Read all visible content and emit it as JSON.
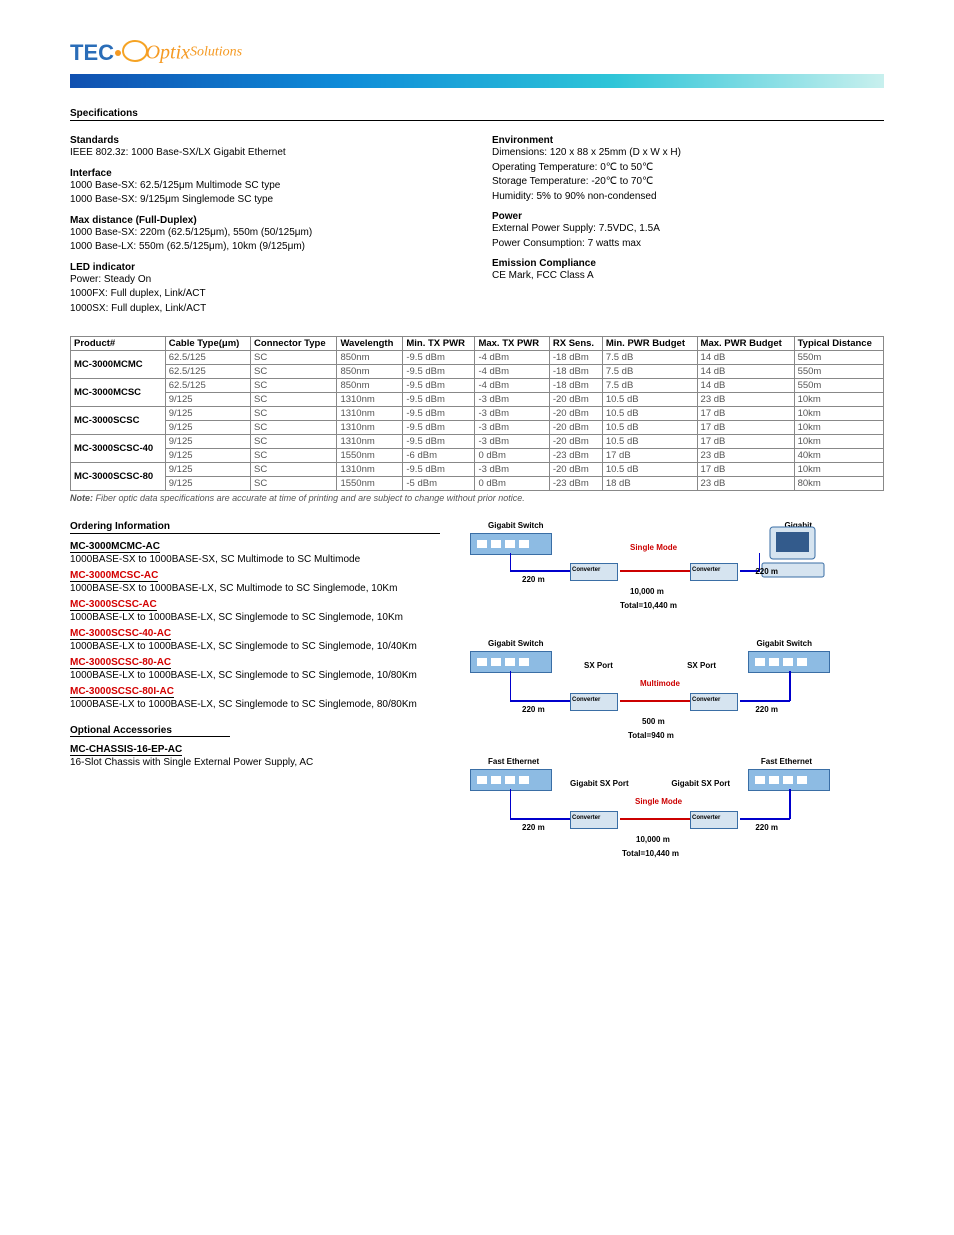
{
  "logo": {
    "part1": "TEC",
    "part2": "Optix",
    "part3": "Solutions"
  },
  "specs_title": "Specifications",
  "standards": {
    "heading": "Standards",
    "items": [
      {
        "k": "IEEE 802.3z:",
        "v": "1000 Base-SX/LX Gigabit Ethernet"
      }
    ],
    "interface_heading": "Interface",
    "interface": [
      {
        "k": "1000 Base-SX:",
        "v": "62.5/125μm Multimode SC type"
      },
      {
        "k": "1000 Base-SX:",
        "v": "9/125μm Singlemode SC type"
      }
    ],
    "distance_heading": "Max distance (Full-Duplex)",
    "distance": [
      {
        "k": "1000 Base-SX:",
        "v": "220m (62.5/125μm), 550m (50/125μm)"
      },
      {
        "k": "1000 Base-LX:",
        "v": "550m (62.5/125μm), 10km (9/125μm)"
      }
    ],
    "led_heading": "LED indicator",
    "led": [
      {
        "k": "Power:",
        "v": "Steady On"
      },
      {
        "k": "1000FX:",
        "v": "Full duplex, Link/ACT"
      },
      {
        "k": "1000SX:",
        "v": "Full duplex, Link/ACT"
      }
    ]
  },
  "env": {
    "heading": "Environment",
    "items": [
      {
        "k": "Dimensions:",
        "v": "120 x 88 x 25mm (D x W x H)"
      },
      {
        "k": "Operating Temperature:",
        "v": "0℃ to 50℃"
      },
      {
        "k": "Storage Temperature:",
        "v": "-20℃ to 70℃"
      },
      {
        "k": "Humidity:",
        "v": "5% to 90% non-condensed"
      }
    ],
    "power_heading": "Power",
    "power": [
      {
        "k": "External Power Supply:",
        "v": "7.5VDC, 1.5A"
      },
      {
        "k": "Power Consumption:",
        "v": "7 watts max"
      }
    ],
    "emission_heading": "Emission Compliance",
    "emission": [
      {
        "k": "",
        "v": "CE Mark, FCC Class A"
      }
    ]
  },
  "note_label": "Note:",
  "note_text": "Fiber optic data specifications are accurate at time of printing and are subject to change without prior notice.",
  "table": {
    "headers": [
      "Product#",
      "Cable Type(μm)",
      "Connector Type",
      "Wavelength",
      "Min. TX PWR",
      "Max. TX PWR",
      "RX Sens.",
      "Min. PWR Budget",
      "Max. PWR Budget",
      "Typical Distance"
    ],
    "rows": [
      {
        "product": "MC-3000MCMC",
        "sub": [
          {
            "c": [
              "62.5/125",
              "SC",
              "850nm",
              "-9.5 dBm",
              "-4 dBm",
              "-18 dBm",
              "7.5 dB",
              "14 dB",
              "550m"
            ]
          },
          {
            "c": [
              "62.5/125",
              "SC",
              "850nm",
              "-9.5 dBm",
              "-4 dBm",
              "-18 dBm",
              "7.5 dB",
              "14 dB",
              "550m"
            ]
          }
        ]
      },
      {
        "product": "MC-3000MCSC",
        "sub": [
          {
            "c": [
              "62.5/125",
              "SC",
              "850nm",
              "-9.5 dBm",
              "-4 dBm",
              "-18 dBm",
              "7.5 dB",
              "14 dB",
              "550m"
            ]
          },
          {
            "c": [
              "9/125",
              "SC",
              "1310nm",
              "-9.5 dBm",
              "-3 dBm",
              "-20 dBm",
              "10.5 dB",
              "23 dB",
              "10km"
            ]
          }
        ]
      },
      {
        "product": "MC-3000SCSC",
        "sub": [
          {
            "c": [
              "9/125",
              "SC",
              "1310nm",
              "-9.5 dBm",
              "-3 dBm",
              "-20 dBm",
              "10.5 dB",
              "17 dB",
              "10km"
            ]
          },
          {
            "c": [
              "9/125",
              "SC",
              "1310nm",
              "-9.5 dBm",
              "-3 dBm",
              "-20 dBm",
              "10.5 dB",
              "17 dB",
              "10km"
            ]
          }
        ]
      },
      {
        "product": "MC-3000SCSC-40",
        "sub": [
          {
            "c": [
              "9/125",
              "SC",
              "1310nm",
              "-9.5 dBm",
              "-3 dBm",
              "-20 dBm",
              "10.5 dB",
              "17 dB",
              "10km"
            ]
          },
          {
            "c": [
              "9/125",
              "SC",
              "1550nm",
              "-6 dBm",
              "0 dBm",
              "-23 dBm",
              "17 dB",
              "23 dB",
              "40km"
            ]
          }
        ]
      },
      {
        "product": "MC-3000SCSC-80",
        "sub": [
          {
            "c": [
              "9/125",
              "SC",
              "1310nm",
              "-9.5 dBm",
              "-3 dBm",
              "-20 dBm",
              "10.5 dB",
              "17 dB",
              "10km"
            ]
          },
          {
            "c": [
              "9/125",
              "SC",
              "1550nm",
              "-5 dBm",
              "0 dBm",
              "-23 dBm",
              "18 dB",
              "23 dB",
              "80km"
            ]
          }
        ]
      }
    ]
  },
  "ordering_title": "Ordering Information",
  "ordering": [
    {
      "pn": "MC-3000MCMC-AC",
      "desc": "1000BASE-SX to 1000BASE-SX, SC Multimode to SC Multimode",
      "red": false
    },
    {
      "pn": "MC-3000MCSC-AC",
      "desc": "1000BASE-SX to 1000BASE-LX, SC Multimode to SC Singlemode, 10Km",
      "red": true
    },
    {
      "pn": "MC-3000SCSC-AC",
      "desc": "1000BASE-LX to 1000BASE-LX, SC Singlemode to SC Singlemode, 10Km",
      "red": true
    },
    {
      "pn": "MC-3000SCSC-40-AC",
      "desc": "1000BASE-LX to 1000BASE-LX, SC Singlemode to SC Singlemode, 10/40Km",
      "red": true
    },
    {
      "pn": "MC-3000SCSC-80-AC",
      "desc": "1000BASE-LX to 1000BASE-LX, SC Singlemode to SC Singlemode, 10/80Km",
      "red": true
    },
    {
      "pn": "MC-3000SCSC-80I-AC",
      "desc": "1000BASE-LX to 1000BASE-LX, SC Singlemode to SC Singlemode, 80/80Km",
      "red": true
    }
  ],
  "access_title": "Optional Accessories",
  "access": [
    {
      "pn": "MC-CHASSIS-16-EP-AC",
      "desc": "16-Slot Chassis with Single External Power Supply, AC",
      "red": false
    }
  ],
  "diagram": {
    "sec1": {
      "title": "Gigabit Switch",
      "right": "Gigabit",
      "mode": "Single Mode",
      "d1": "220 m",
      "mid": "10,000 m",
      "d2": "220 m",
      "total": "Total=10,440 m",
      "conv1": "Converter",
      "conv2": "Converter"
    },
    "sec2": {
      "titleL": "Gigabit Switch",
      "titleR": "Gigabit Switch",
      "portL": "SX Port",
      "portR": "SX Port",
      "mode": "Multimode",
      "d1": "220 m",
      "mid": "500 m",
      "d2": "220 m",
      "total": "Total=940 m",
      "conv1": "Converter",
      "conv2": "Converter"
    },
    "sec3": {
      "titleL": "Fast Ethernet",
      "titleR": "Fast Ethernet",
      "portL": "Gigabit SX Port",
      "portR": "Gigabit SX Port",
      "mode": "Single Mode",
      "d1": "220 m",
      "mid": "10,000 m",
      "d2": "220 m",
      "total": "Total=10,440 m",
      "conv1": "Converter",
      "conv2": "Converter"
    }
  }
}
